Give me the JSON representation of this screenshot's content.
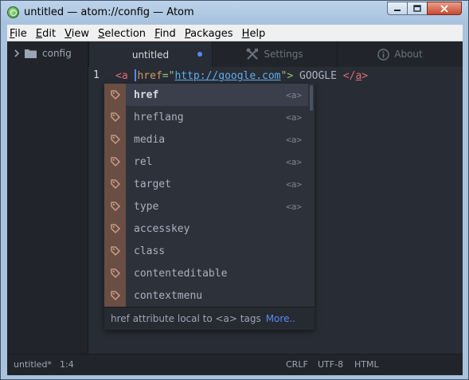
{
  "window": {
    "title": "untitled — atom://config — Atom",
    "controls": {
      "minimize": "minimize",
      "maximize": "maximize",
      "close": "close"
    }
  },
  "menu": [
    {
      "first": "F",
      "rest": "ile"
    },
    {
      "first": "E",
      "rest": "dit"
    },
    {
      "first": "V",
      "rest": "iew"
    },
    {
      "first": "S",
      "rest": "election"
    },
    {
      "first": "F",
      "rest": "ind"
    },
    {
      "first": "P",
      "rest": "ackages"
    },
    {
      "first": "H",
      "rest": "elp"
    }
  ],
  "tree": {
    "folder": "config"
  },
  "tabs": {
    "untitled": "untitled",
    "settings": "Settings",
    "about": "About"
  },
  "editor": {
    "line_number": "1",
    "code": {
      "open_lt": "<",
      "open_tag": "a",
      "attr": "href",
      "eq": "=\"",
      "url": "http://google.com",
      "close_q": "\">",
      "text": " GOOGLE ",
      "end_lt": "</",
      "end_tag": "a",
      "end_gt": ">"
    }
  },
  "autocomplete": {
    "items": [
      {
        "label": "href",
        "right": "<a>"
      },
      {
        "label": "hreflang",
        "right": "<a>"
      },
      {
        "label": "media",
        "right": "<a>"
      },
      {
        "label": "rel",
        "right": "<a>"
      },
      {
        "label": "target",
        "right": "<a>"
      },
      {
        "label": "type",
        "right": "<a>"
      },
      {
        "label": "accesskey",
        "right": ""
      },
      {
        "label": "class",
        "right": ""
      },
      {
        "label": "contenteditable",
        "right": ""
      },
      {
        "label": "contextmenu",
        "right": ""
      }
    ],
    "description": "href attribute local to <a> tags",
    "more": "More.."
  },
  "status": {
    "file": "untitled*",
    "position": "1:4",
    "line_ending": "CRLF",
    "encoding": "UTF-8",
    "grammar": "HTML"
  }
}
